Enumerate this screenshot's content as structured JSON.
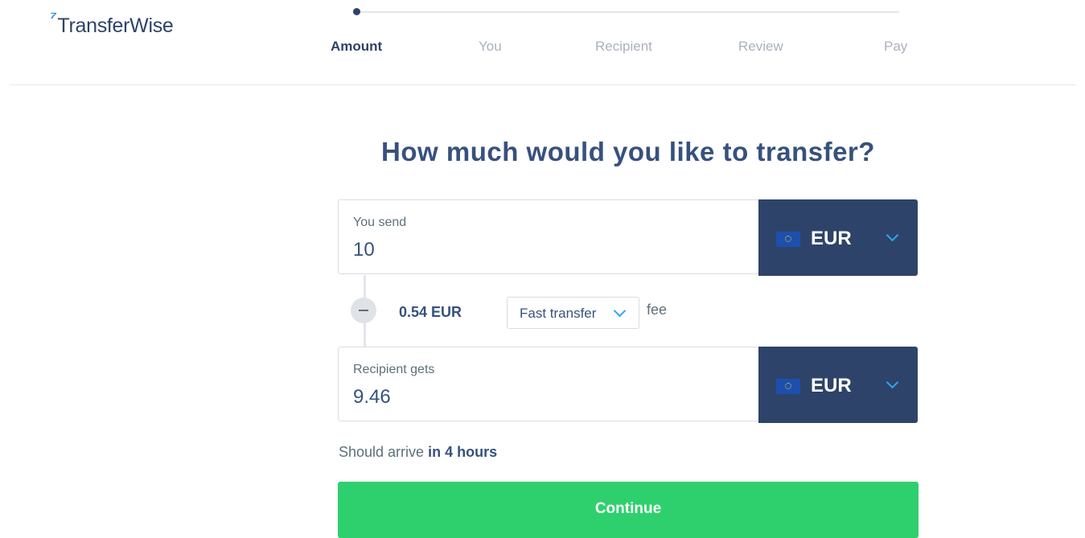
{
  "brand": {
    "logo_mark": "Ʒ",
    "name": "TransferWise",
    "accent_color": "#2f8fdc"
  },
  "progress": {
    "current_step": 1,
    "steps": [
      {
        "label": "Amount",
        "active": true
      },
      {
        "label": "You",
        "active": false
      },
      {
        "label": "Recipient",
        "active": false
      },
      {
        "label": "Review",
        "active": false
      },
      {
        "label": "Pay",
        "active": false
      }
    ]
  },
  "main": {
    "heading": "How much would you like to transfer?"
  },
  "send": {
    "label": "You send",
    "value": "10",
    "currency": "EUR",
    "currency_icon": "eu-flag-icon"
  },
  "fee": {
    "amount": "0.54 EUR",
    "option": "Fast transfer",
    "suffix": "fee"
  },
  "receive": {
    "label": "Recipient gets",
    "value": "9.46",
    "currency": "EUR",
    "currency_icon": "eu-flag-icon"
  },
  "arrival": {
    "prefix": "Should arrive",
    "emphasis": "in 4 hours"
  },
  "actions": {
    "continue_label": "Continue",
    "continue_color": "#2ed06e"
  },
  "colors": {
    "navy": "#2e4369",
    "chevron": "#2ea6f4"
  }
}
